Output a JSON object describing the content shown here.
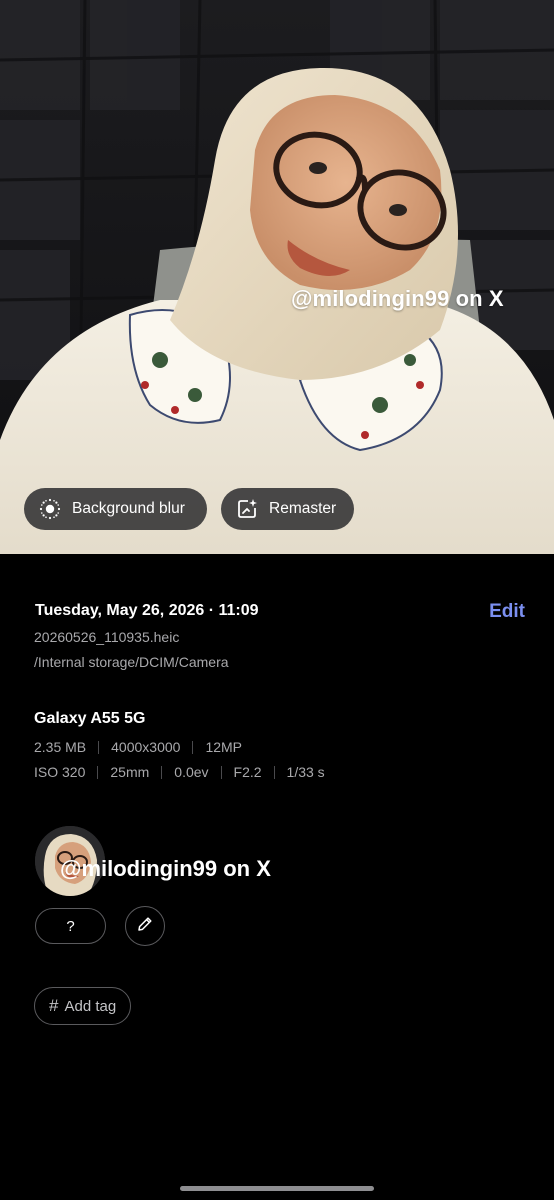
{
  "photo": {
    "watermark": "@milodingin99 on X",
    "chips": {
      "background_blur": "Background blur",
      "remaster": "Remaster"
    }
  },
  "details": {
    "date": "Tuesday, May 26, 2026 · 11:09",
    "edit_label": "Edit",
    "filename": "20260526_110935.heic",
    "path": "/Internal storage/DCIM/Camera",
    "device": "Galaxy A55 5G",
    "specs_row1": [
      "2.35 MB",
      "4000x3000",
      "12MP"
    ],
    "specs_row2": [
      "ISO 320",
      "25mm",
      "0.0ev",
      "F2.2",
      "1/33 s"
    ]
  },
  "people": {
    "name": "@milodingin99 on X",
    "unknown_label": "?"
  },
  "tags": {
    "add_tag_label": "Add tag"
  },
  "icons": {
    "background_blur": "background-blur-icon",
    "remaster": "remaster-sparkle-icon",
    "edit_person": "pencil-icon",
    "add_tag": "hash-icon"
  },
  "colors": {
    "accent": "#7b8ff0",
    "background": "#000000",
    "secondary_text": "#a9a9ac"
  }
}
